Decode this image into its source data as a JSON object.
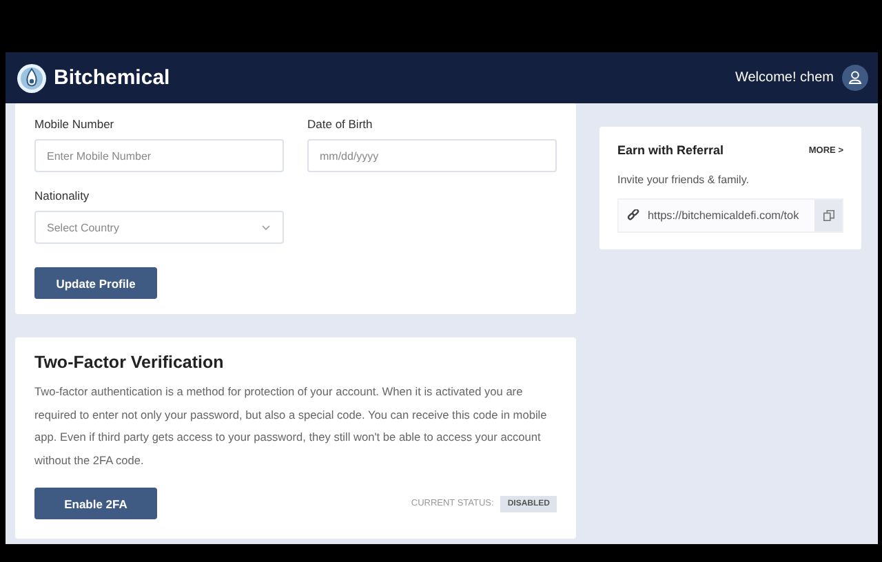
{
  "header": {
    "brand": "Bitchemical",
    "welcome": "Welcome! chem"
  },
  "profile_form": {
    "fields": [
      {
        "kind": "input",
        "label": "Mobile Number",
        "placeholder": "Enter Mobile Number"
      },
      {
        "kind": "input",
        "label": "Date of Birth",
        "placeholder": "mm/dd/yyyy"
      },
      {
        "kind": "select",
        "label": "Nationality",
        "placeholder": "Select Country"
      }
    ],
    "button": "Update Profile"
  },
  "two_factor": {
    "title": "Two-Factor Verification",
    "description": "Two-factor authentication is a method for protection of your account. When it is activated you are required to enter not only your password, but also a special code. You can receive this code in mobile app. Even if third party gets access to your password, they still won't be able to access your account without the 2FA code.",
    "button": "Enable 2FA",
    "status_label": "CURRENT STATUS:",
    "status": "DISABLED"
  },
  "referral": {
    "title": "Earn with Referral",
    "more": "MORE >",
    "subtitle": "Invite your friends & family.",
    "link": "https://bitchemicaldefi.com/tok"
  }
}
